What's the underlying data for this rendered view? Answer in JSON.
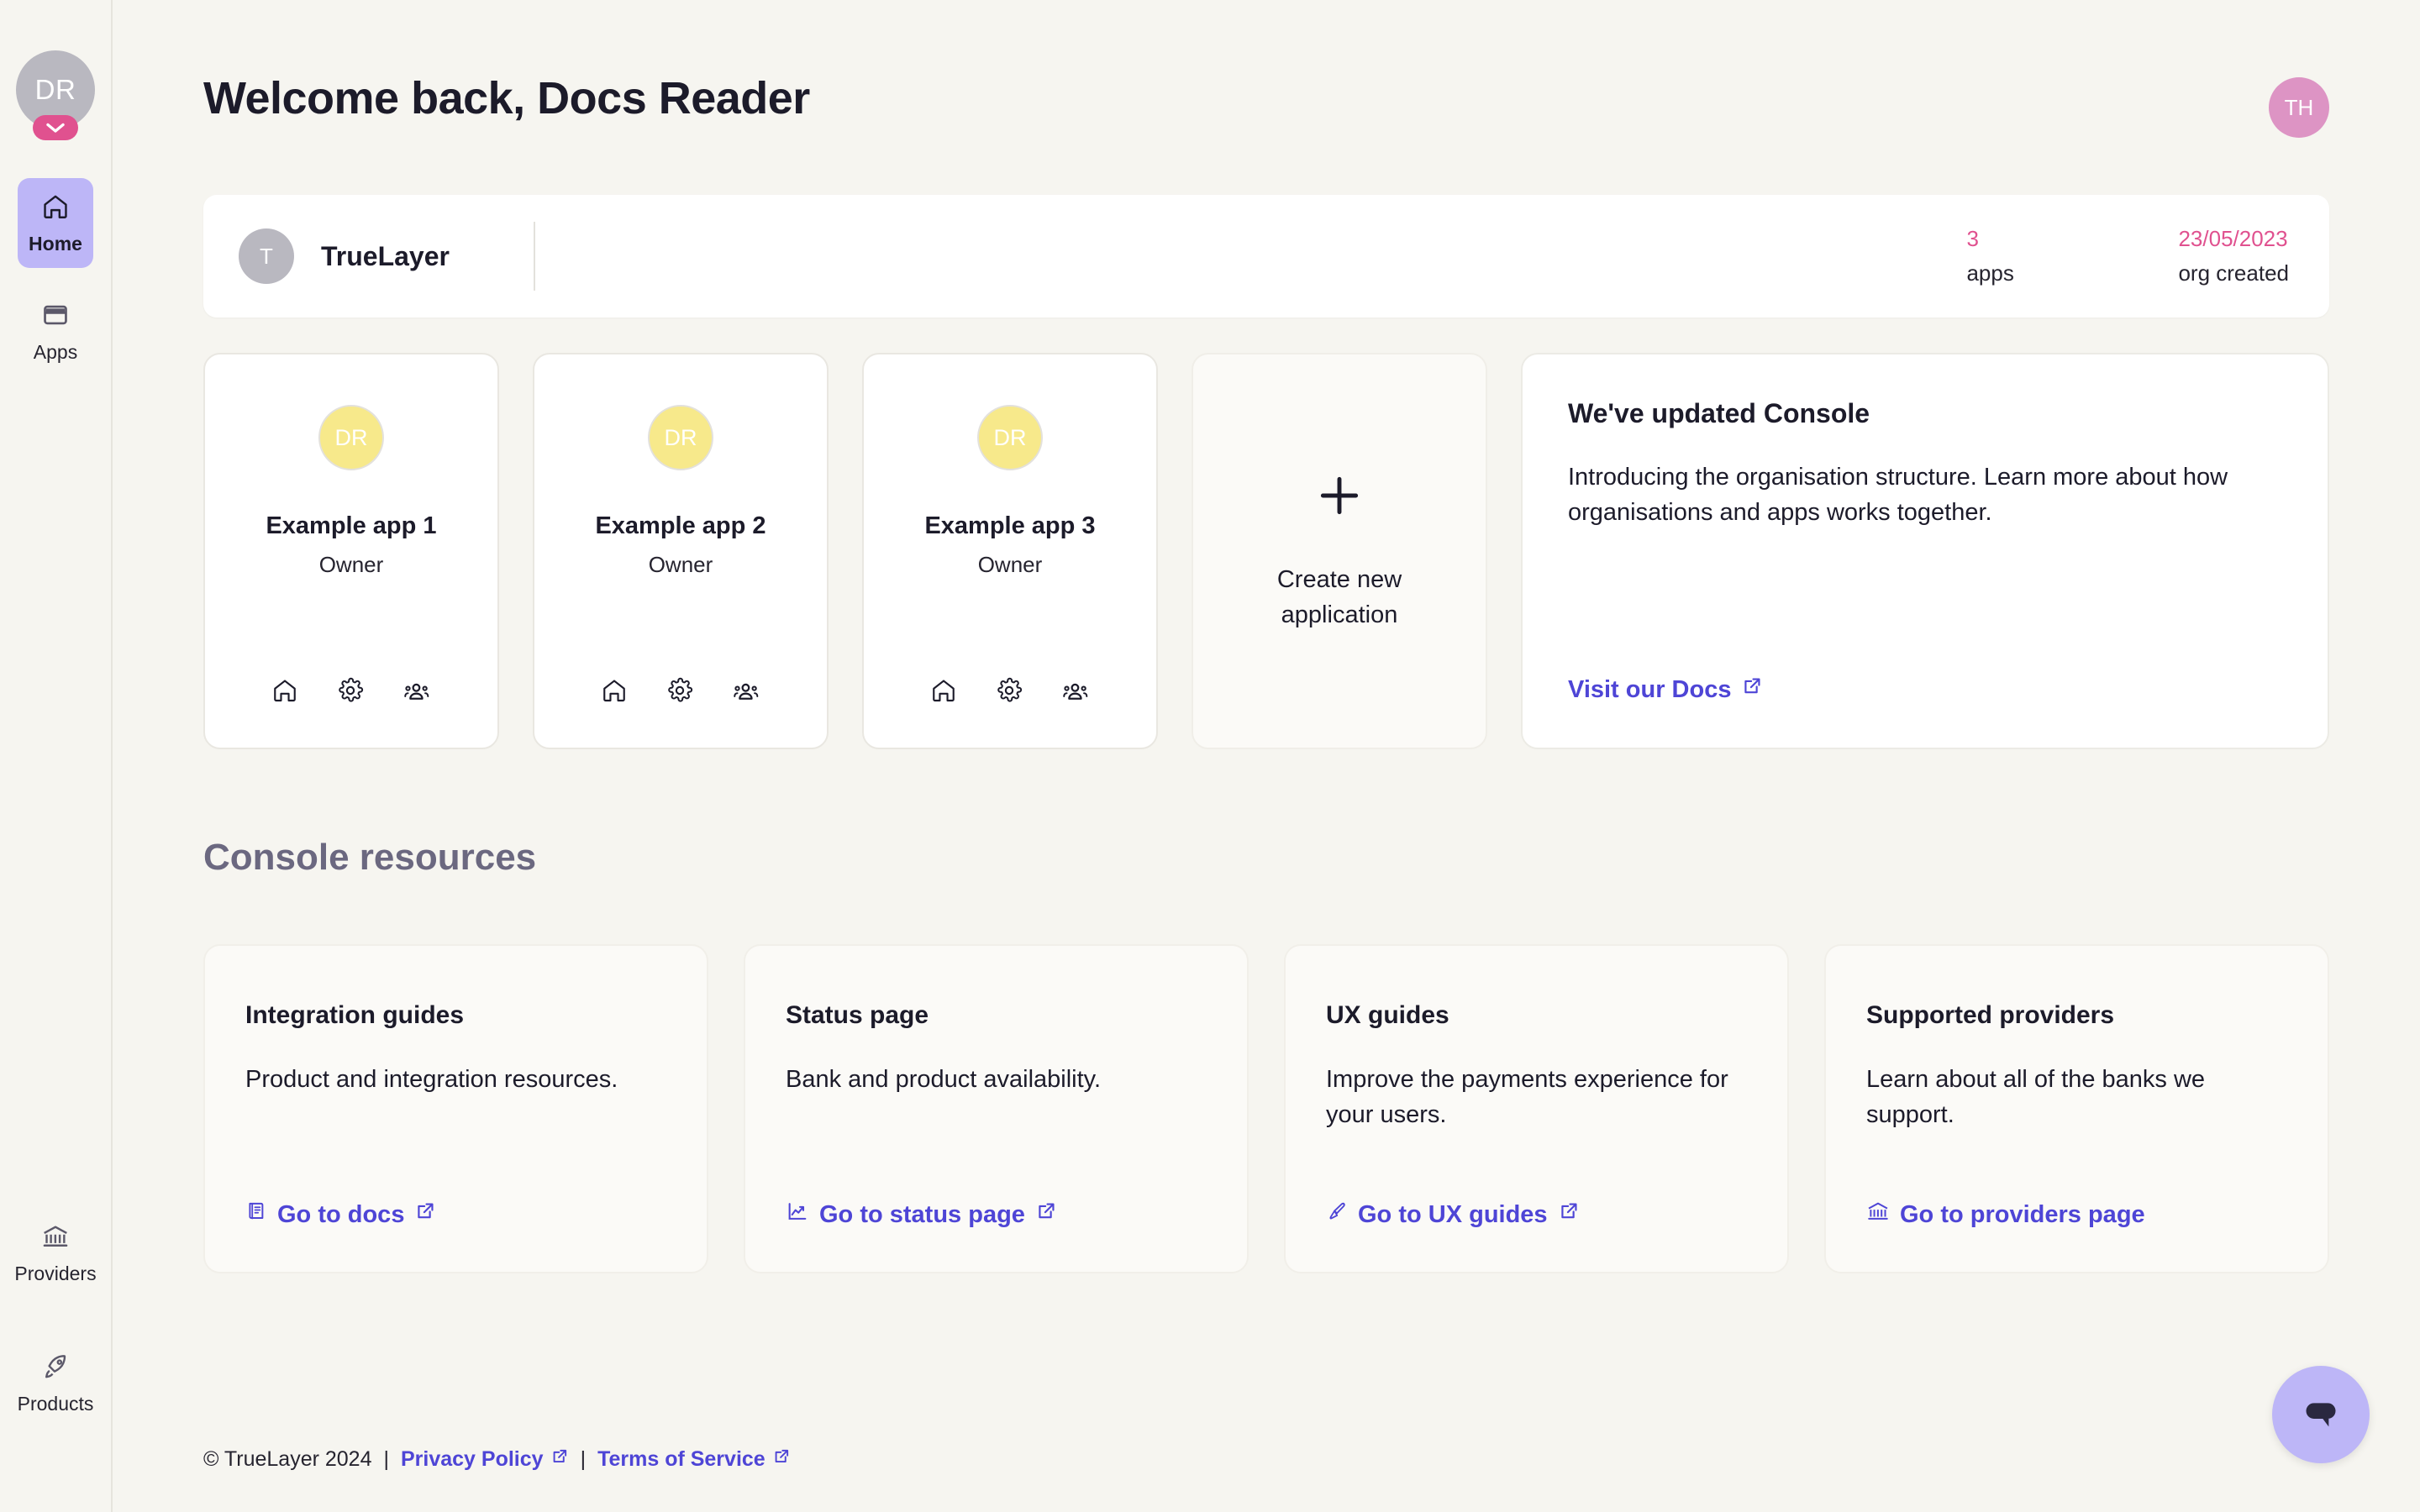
{
  "sidebar": {
    "user_avatar_initials": "DR",
    "avatar_chevron_icon": "chevron-down-icon",
    "items": [
      {
        "label": "Home",
        "icon": "home-icon",
        "active": true
      },
      {
        "label": "Apps",
        "icon": "window-icon",
        "active": false
      }
    ],
    "bottom_items": [
      {
        "label": "Providers",
        "icon": "bank-icon"
      },
      {
        "label": "Products",
        "icon": "rocket-icon"
      }
    ]
  },
  "header": {
    "title": "Welcome back, Docs Reader",
    "account_avatar_initials": "TH"
  },
  "org_card": {
    "logo_initial": "T",
    "name": "TrueLayer",
    "stats": [
      {
        "value": "3",
        "label": "apps"
      },
      {
        "value": "23/05/2023",
        "label": "org created"
      }
    ]
  },
  "apps": [
    {
      "avatar_initials": "DR",
      "name": "Example app 1",
      "role": "Owner",
      "actions": [
        "home-icon",
        "gear-icon",
        "users-icon"
      ]
    },
    {
      "avatar_initials": "DR",
      "name": "Example app 2",
      "role": "Owner",
      "actions": [
        "home-icon",
        "gear-icon",
        "users-icon"
      ]
    },
    {
      "avatar_initials": "DR",
      "name": "Example app 3",
      "role": "Owner",
      "actions": [
        "home-icon",
        "gear-icon",
        "users-icon"
      ]
    }
  ],
  "create_card": {
    "plus_icon": "plus-icon",
    "label_line1": "Create new",
    "label_line2": "application"
  },
  "promo": {
    "title": "We've updated Console",
    "body": "Introducing the organisation structure. Learn more about how organisations and apps works together.",
    "link_label": "Visit our Docs",
    "link_icon": "external-link-icon"
  },
  "resources": {
    "section_title": "Console resources",
    "cards": [
      {
        "title": "Integration guides",
        "desc": "Product and integration resources.",
        "link_label": "Go to docs",
        "lead_icon": "book-icon",
        "link_icon": "external-link-icon"
      },
      {
        "title": "Status page",
        "desc": "Bank and product availability.",
        "link_label": "Go to status page",
        "lead_icon": "chart-line-icon",
        "link_icon": "external-link-icon"
      },
      {
        "title": "UX guides",
        "desc": "Improve the payments experience for your users.",
        "link_label": "Go to UX guides",
        "lead_icon": "paintbrush-icon",
        "link_icon": "external-link-icon"
      },
      {
        "title": "Supported providers",
        "desc": "Learn about all of the banks we support.",
        "link_label": "Go to providers page",
        "lead_icon": "bank-icon",
        "link_icon": ""
      }
    ]
  },
  "footer": {
    "copyright": "© TrueLayer 2024",
    "separator": "|",
    "privacy_label": "Privacy Policy",
    "terms_label": "Terms of Service"
  },
  "chat": {
    "icon": "chat-bubble-icon"
  },
  "colors": {
    "page_bg": "#f6f5f0",
    "accent_purple": "#4e45d6",
    "active_nav": "#bdb6f7",
    "pink": "#e0518f",
    "app_avatar_yellow": "#f7e98b"
  }
}
